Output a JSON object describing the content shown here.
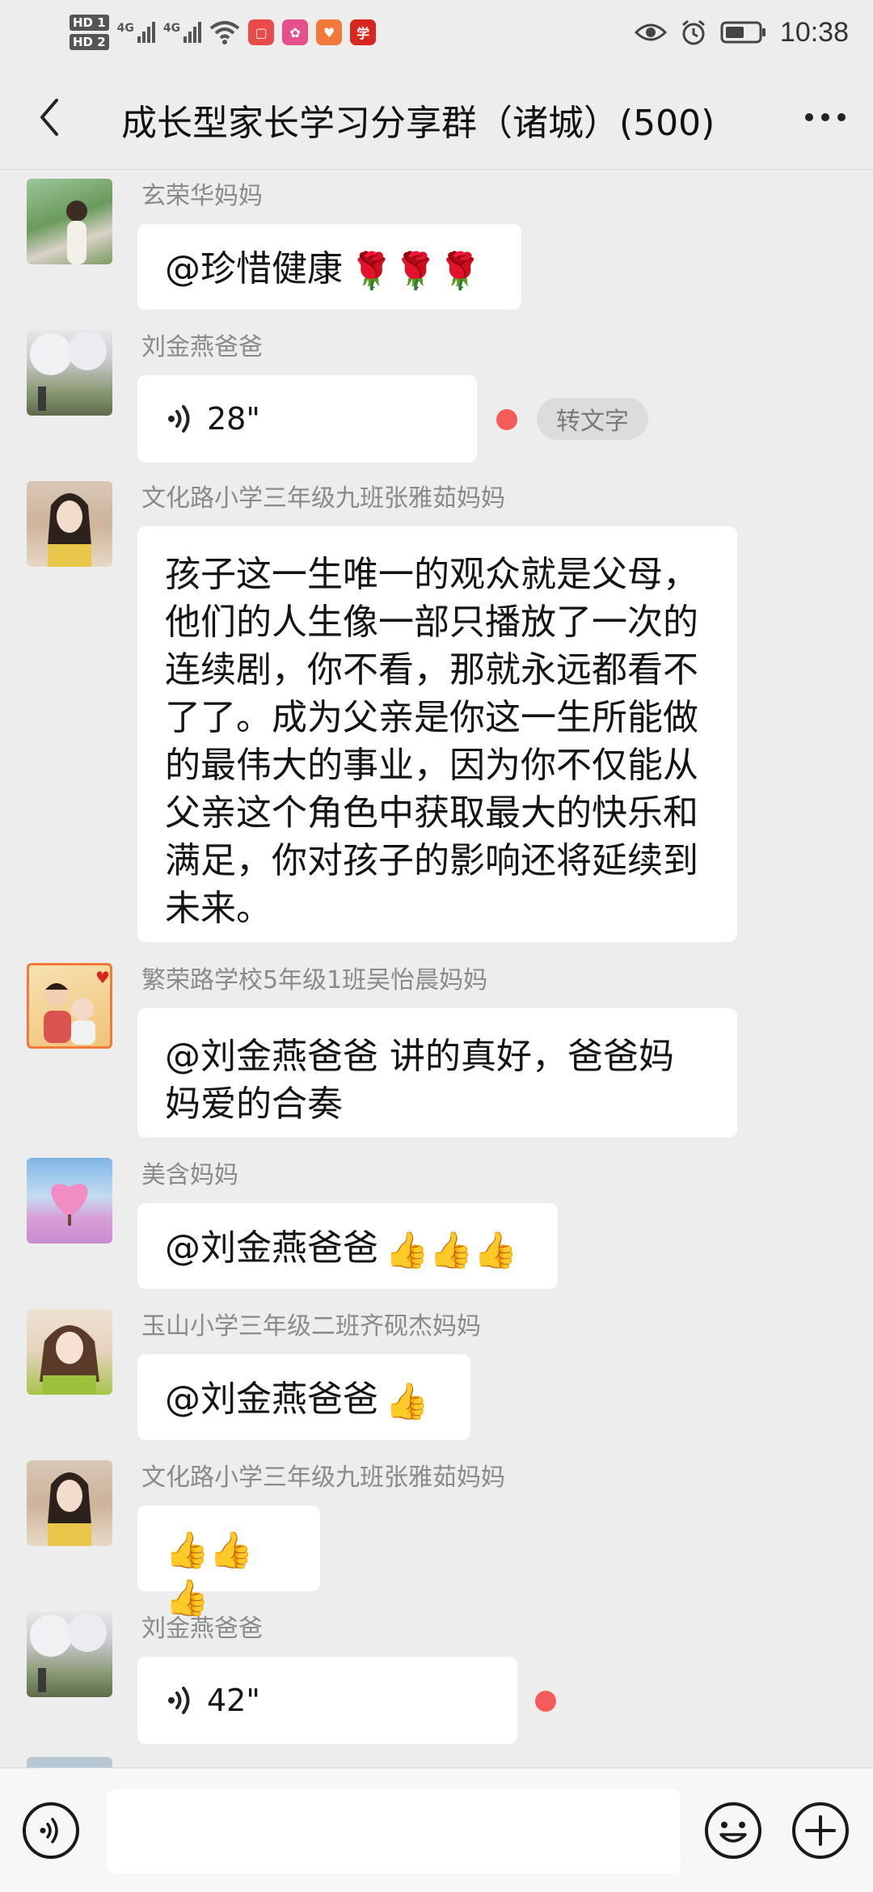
{
  "status_bar": {
    "sim1": "HD 1",
    "sim2": "HD 2",
    "network1": "4G",
    "network2": "4G",
    "apps": [
      {
        "name": "red-square-app-icon",
        "color": "#e94b4b",
        "glyph": "▢"
      },
      {
        "name": "pink-app-icon",
        "color": "#e5508a",
        "glyph": "✿"
      },
      {
        "name": "orange-heart-app-icon",
        "color": "#f07a3c",
        "glyph": "♥"
      },
      {
        "name": "xuexi-app-icon",
        "color": "#d7261e",
        "glyph": "学"
      }
    ],
    "time": "10:38"
  },
  "header": {
    "title": "成长型家长学习分享群（诸城）(500)"
  },
  "messages": [
    {
      "sender": "玄荣华妈妈",
      "text": "@珍惜健康",
      "emoji": "🌹🌹🌹"
    },
    {
      "sender": "刘金燕爸爸",
      "duration": "28\"",
      "convert_label": "转文字"
    },
    {
      "sender": "文化路小学三年级九班张雅茹妈妈",
      "lines": [
        "孩子这一生唯一的观众就是父母，",
        "他们的人生像一部只播放了一次的",
        "连续剧，你不看，那就永远都看不",
        "了了。成为父亲是你这一生所能做",
        "的最伟大的事业，因为你不仅能从",
        "父亲这个角色中获取最大的快乐和",
        "满足，你对孩子的影响还将延续到",
        "未来。"
      ]
    },
    {
      "sender": "繁荣路学校5年级1班吴怡晨妈妈",
      "lines": [
        "@刘金燕爸爸  讲的真好，爸爸妈",
        "妈爱的合奏"
      ]
    },
    {
      "sender": "美含妈妈",
      "text": "@刘金燕爸爸",
      "emoji": "👍👍👍"
    },
    {
      "sender": "玉山小学三年级二班齐砚杰妈妈",
      "text": "@刘金燕爸爸",
      "emoji": "👍"
    },
    {
      "sender": "文化路小学三年级九班张雅茹妈妈",
      "emoji": "👍👍👍"
    },
    {
      "sender": "刘金燕爸爸",
      "duration": "42\""
    }
  ]
}
